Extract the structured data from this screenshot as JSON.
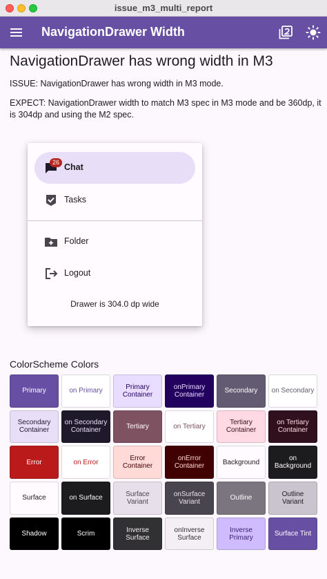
{
  "window": {
    "title": "issue_m3_multi_report"
  },
  "appbar": {
    "title": "NavigationDrawer Width",
    "menu_icon": "menu-icon",
    "action_icons": [
      "filter-2-icon",
      "brightness-icon"
    ],
    "color": "#6750a4"
  },
  "content": {
    "heading": "NavigationDrawer has wrong width in M3",
    "issue": "ISSUE: NavigationDrawer has wrong width in M3 mode.",
    "expect": "EXPECT: NavigationDrawer width to match M3 spec in M3 mode and be 360dp, it is 304dp and using the M2 spec."
  },
  "drawer": {
    "items": [
      {
        "label": "Chat",
        "icon": "chat-icon",
        "badge": "26",
        "selected": true
      },
      {
        "label": "Tasks",
        "icon": "task-check-icon"
      },
      {
        "label": "Folder",
        "icon": "folder-add-icon"
      },
      {
        "label": "Logout",
        "icon": "logout-icon"
      }
    ],
    "note": "Drawer is 304.0 dp wide"
  },
  "colorscheme": {
    "title": "ColorScheme Colors",
    "cells": [
      {
        "label": "Primary",
        "bg": "#6750a4",
        "fg": "#ffffff"
      },
      {
        "label": "on Primary",
        "bg": "#ffffff",
        "fg": "#6750a4"
      },
      {
        "label": "Primary Container",
        "bg": "#e9ddff",
        "fg": "#22005d"
      },
      {
        "label": "onPrimary Container",
        "bg": "#22005d",
        "fg": "#e9ddff"
      },
      {
        "label": "Secondary",
        "bg": "#625b71",
        "fg": "#ffffff"
      },
      {
        "label": "on Secondary",
        "bg": "#ffffff",
        "fg": "#625b71"
      },
      {
        "label": "Secondary Container",
        "bg": "#e8def8",
        "fg": "#1e192b"
      },
      {
        "label": "on Secondary Container",
        "bg": "#1e192b",
        "fg": "#e8def8"
      },
      {
        "label": "Tertiary",
        "bg": "#7e5260",
        "fg": "#ffffff"
      },
      {
        "label": "on Tertiary",
        "bg": "#ffffff",
        "fg": "#7e5260"
      },
      {
        "label": "Tertiary Container",
        "bg": "#ffd9e3",
        "fg": "#31101d"
      },
      {
        "label": "on Tertiary Container",
        "bg": "#31101d",
        "fg": "#ffd9e3"
      },
      {
        "label": "Error",
        "bg": "#ba1a1a",
        "fg": "#ffffff"
      },
      {
        "label": "on Error",
        "bg": "#ffffff",
        "fg": "#ba1a1a"
      },
      {
        "label": "Error Container",
        "bg": "#ffdad6",
        "fg": "#410002"
      },
      {
        "label": "onError Container",
        "bg": "#410002",
        "fg": "#ffdad6"
      },
      {
        "label": "Background",
        "bg": "#fffbff",
        "fg": "#1c1b1e"
      },
      {
        "label": "on Background",
        "bg": "#1c1b1e",
        "fg": "#fffbff"
      },
      {
        "label": "Surface",
        "bg": "#fffbff",
        "fg": "#1c1b1e"
      },
      {
        "label": "on Surface",
        "bg": "#1c1b1e",
        "fg": "#fffbff"
      },
      {
        "label": "Surface Variant",
        "bg": "#e7e0eb",
        "fg": "#49454e"
      },
      {
        "label": "onSurface Variant",
        "bg": "#49454e",
        "fg": "#e7e0eb"
      },
      {
        "label": "Outline",
        "bg": "#7a757f",
        "fg": "#ffffff"
      },
      {
        "label": "Outline Variant",
        "bg": "#cac4cf",
        "fg": "#1c1b1e"
      },
      {
        "label": "Shadow",
        "bg": "#000000",
        "fg": "#ffffff"
      },
      {
        "label": "Scrim",
        "bg": "#000000",
        "fg": "#ffffff"
      },
      {
        "label": "Inverse Surface",
        "bg": "#313033",
        "fg": "#f4eff4"
      },
      {
        "label": "onInverse Surface",
        "bg": "#f4eff4",
        "fg": "#313033"
      },
      {
        "label": "Inverse Primary",
        "bg": "#cfbcff",
        "fg": "#381e72"
      },
      {
        "label": "Surface Tint",
        "bg": "#6750a4",
        "fg": "#ffffff"
      }
    ]
  }
}
